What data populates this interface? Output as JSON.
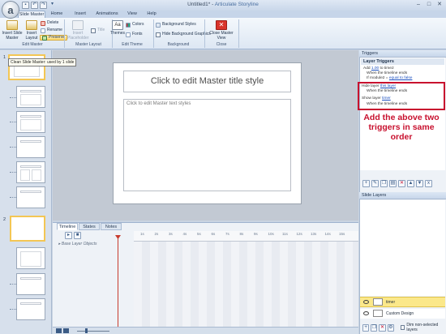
{
  "window": {
    "title": "Untitled1*",
    "separator": " - ",
    "app_name": "Articulate Storyline",
    "controls": [
      "minimize-icon",
      "maximize-icon",
      "close-icon"
    ]
  },
  "app_orb": {
    "glyph": "a",
    "icon": "articulate-logo-icon"
  },
  "quick_access": [
    {
      "icon": "save-icon",
      "glyph": "▪"
    },
    {
      "icon": "undo-icon",
      "glyph": "↶"
    },
    {
      "icon": "redo-icon",
      "glyph": "↷"
    },
    {
      "icon": "customize-icon",
      "glyph": "▾"
    }
  ],
  "tabs": [
    "Slide Master",
    "Home",
    "Insert",
    "Animations",
    "View",
    "Help"
  ],
  "ribbon": {
    "insert_slide_master": "Insert Slide Master",
    "insert_layout": "Insert Layout",
    "delete": "Delete",
    "rename": "Rename",
    "preserve": "Preserve",
    "insert_placeholder": "Insert Placeholder",
    "title_check": "Title",
    "themes": "Themes",
    "colors": "Colors",
    "fonts": "Fonts",
    "background_styles": "Background Styles",
    "hide_background_graphics": "Hide Background Graphics",
    "close_master_view": "Close Master View",
    "groups": [
      "Edit Master",
      "Master Layout",
      "Edit Theme",
      "Background",
      "Close"
    ]
  },
  "slide_panel": {
    "master_number": "1",
    "layout_number": "2",
    "tooltip": "Clean Slide Master: used by 1 slide"
  },
  "slide": {
    "title_placeholder": "Click to edit Master title style",
    "body_placeholder": "Click to edit Master text styles"
  },
  "timeline": {
    "tabs": [
      "Timeline",
      "States",
      "Notes"
    ],
    "base_layer": "Base Layer Objects",
    "ruler_ticks": [
      "1s",
      "2s",
      "3s",
      "4s",
      "5s",
      "6s",
      "7s",
      "8s",
      "9s",
      "10s",
      "11s",
      "12s",
      "13s",
      "14s",
      "15s"
    ]
  },
  "triggers": {
    "panel_title": "Triggers",
    "section_title": "Layer Triggers",
    "t1_line1_pre": "Add ",
    "t1_line1_link": "1.00",
    "t1_line1_post": " to time2",
    "t1_line2": "When the timeline ends",
    "t1_line3_pre": "If module2 = ",
    "t1_line3_link": "equal to false",
    "t2_line1_pre": "Hide layer ",
    "t2_line1_link": "this layer",
    "t2_line2": "When the timeline ends",
    "t3_line1_pre": "Show layer ",
    "t3_line1_link": "timer",
    "t3_line2": "When the timeline ends",
    "callout": "Add the above two triggers in same order"
  },
  "slide_layers": {
    "panel_title": "Slide Layers",
    "layers": [
      "timer",
      "Custom Design"
    ],
    "dim_label": "Dim non-selected layers"
  },
  "colors": {
    "accent_red": "#c8102e",
    "selected_layer": "#fbe88a",
    "link": "#1b4fbf"
  }
}
